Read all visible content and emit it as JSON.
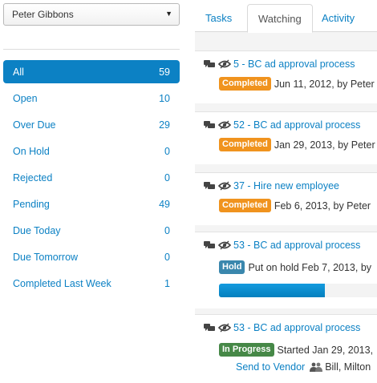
{
  "user_select": {
    "value": "Peter Gibbons"
  },
  "filters": [
    {
      "label": "All",
      "count": "59"
    },
    {
      "label": "Open",
      "count": "10"
    },
    {
      "label": "Over Due",
      "count": "29"
    },
    {
      "label": "On Hold",
      "count": "0"
    },
    {
      "label": "Rejected",
      "count": "0"
    },
    {
      "label": "Pending",
      "count": "49"
    },
    {
      "label": "Due Today",
      "count": "0"
    },
    {
      "label": "Due Tomorrow",
      "count": "0"
    },
    {
      "label": "Completed Last Week",
      "count": "1"
    }
  ],
  "tabs": [
    {
      "label": "Tasks"
    },
    {
      "label": "Watching"
    },
    {
      "label": "Activity"
    }
  ],
  "items": [
    {
      "title": "5 - BC ad approval process",
      "status": "Completed",
      "detail": "Jun 11, 2012, by Peter"
    },
    {
      "title": "52 - BC ad approval process",
      "status": "Completed",
      "detail": "Jan 29, 2013, by Peter"
    },
    {
      "title": "37 - Hire new employee",
      "status": "Completed",
      "detail": "Feb 6, 2013, by Peter"
    },
    {
      "title": "53 - BC ad approval process",
      "status": "Hold",
      "detail": "Put on hold Feb 7, 2013, by",
      "progress": 0.66
    },
    {
      "title": "53 - BC ad approval process",
      "status": "In Progress",
      "detail": "Started Jan 29, 2013,",
      "step": "Send to Vendor",
      "assignees": "Bill, Milton"
    }
  ],
  "colors": {
    "accent": "#0c81c4",
    "completed": "#f0931e",
    "hold": "#3a87ad",
    "in_progress": "#468847"
  },
  "icons": {
    "comments": "comments-icon",
    "watch": "eye-icon",
    "people": "people-icon"
  }
}
